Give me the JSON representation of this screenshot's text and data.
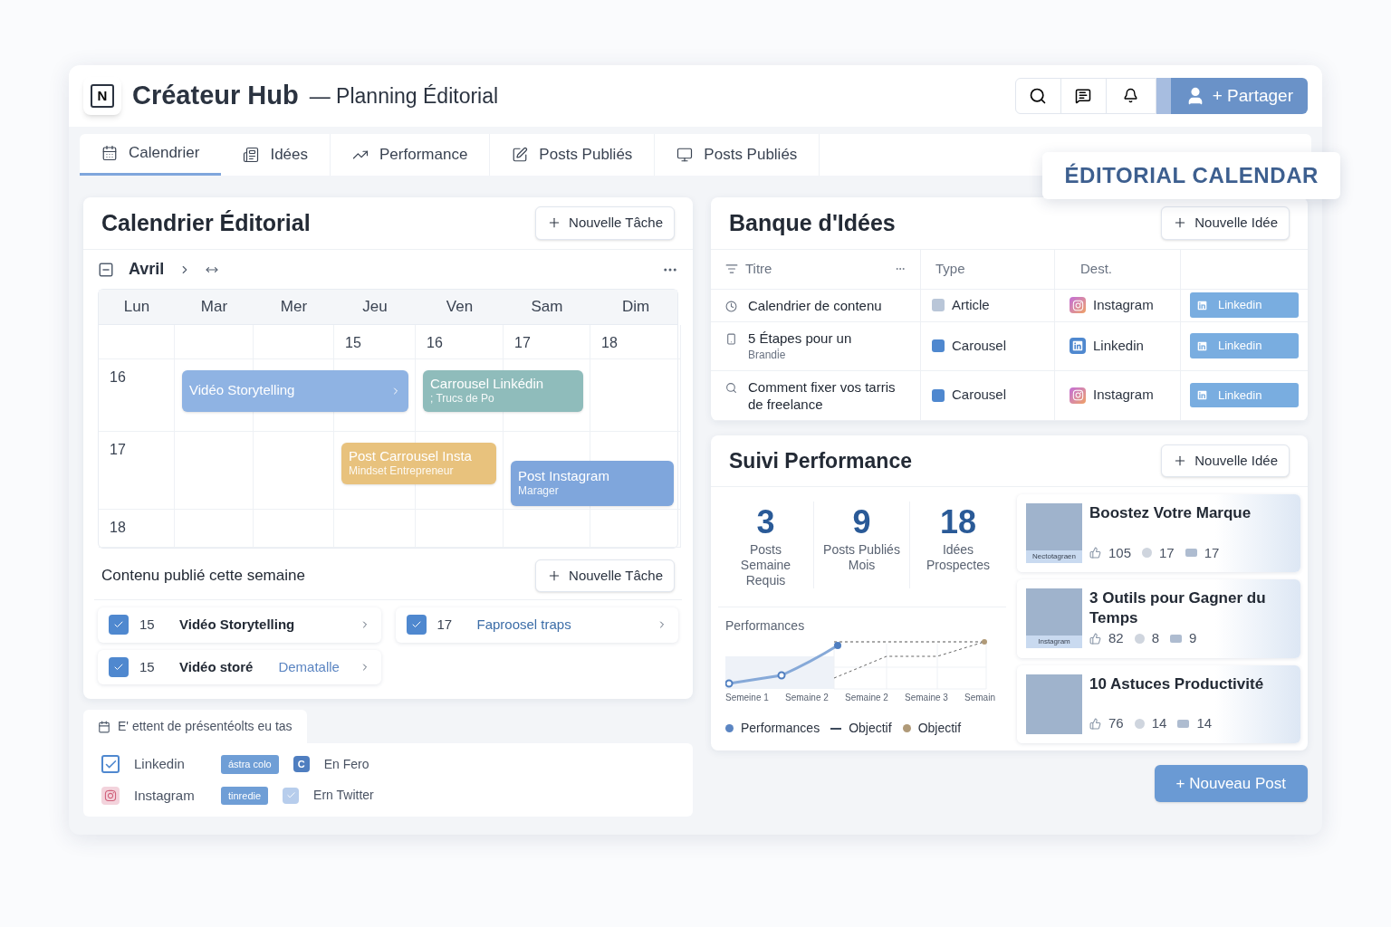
{
  "app": {
    "logo": "N",
    "name": "Créateur Hub",
    "subtitle": "— Planning Éditorial",
    "share_button": "+ Partager"
  },
  "tabs": [
    {
      "label": "Calendrier",
      "selected": true
    },
    {
      "label": "Idées",
      "selected": false
    },
    {
      "label": "Performance",
      "selected": false
    },
    {
      "label": "Posts Publiés",
      "selected": false
    },
    {
      "label": "Posts Publiés",
      "selected": false
    }
  ],
  "floating_badge": "ÉDITORIAL CALENDAR",
  "calendar": {
    "title": "Calendrier Éditorial",
    "new_button": "Nouvelle Tâche",
    "month": "Avril",
    "days": [
      "Lun",
      "Mar",
      "Mer",
      "Jeu",
      "Ven",
      "Sam",
      "Dim"
    ],
    "dates": [
      "15",
      "16",
      "17",
      "18",
      "16",
      "17",
      "18"
    ],
    "events": [
      {
        "title": "Vidéo Storytelling",
        "color": "#8fb3e3"
      },
      {
        "title": "Carrousel Linkédin",
        "subtitle": "; Trucs de Po",
        "color": "#8fbcbb"
      },
      {
        "title": "Post Carrousel Insta",
        "subtitle": "Mindset Entrepreneur",
        "color": "#e8c27d"
      },
      {
        "title": "Post Instagram",
        "subtitle": "Marager",
        "color": "#7fa6dc"
      }
    ]
  },
  "published": {
    "title": "Contenu publié cette semaine",
    "new_button": "Nouvelle Tâche",
    "items": [
      {
        "day": "15",
        "title": "Vidéo Storytelling",
        "highlight": false
      },
      {
        "day": "17",
        "title": "Faproosel traps",
        "highlight": true
      },
      {
        "day": "15",
        "title": "Vidéo storé",
        "tag": "Dematalle",
        "highlight": false
      }
    ]
  },
  "channels": {
    "tab": "E' ettent de présentéolts eu tas",
    "rows": [
      {
        "kind": "checkbox",
        "checked": true,
        "name": "Linkedin",
        "badge": "ástra colo",
        "letter": "C",
        "label": "En Fero"
      },
      {
        "kind": "instagram",
        "name": "Instagram",
        "badge": "tinredie",
        "label": "Ern Twitter"
      }
    ]
  },
  "ideas": {
    "title": "Banque d'Idées",
    "new_button": "Nouvelle Idée",
    "columns": [
      "Titre",
      "Type",
      "Dest."
    ],
    "rows": [
      {
        "title": "Calendrier de contenu",
        "type": {
          "kind": "article",
          "label": "Article"
        },
        "dest": {
          "kind": "instagram",
          "label": "Instagram"
        },
        "action": "Linkedin"
      },
      {
        "title": "5 Étapes pour un",
        "subtitle": "Brandi̇e",
        "type": {
          "kind": "carousel",
          "label": "Carousel"
        },
        "dest": {
          "kind": "linkedin",
          "label": "Linkedin"
        },
        "action": "Linkedin"
      },
      {
        "title": "Comment fixer vos tarris de freelance",
        "type": {
          "kind": "carousel",
          "label": "Carousel"
        },
        "dest": {
          "kind": "instagram",
          "label": "Instagram"
        },
        "action": "Linkedin"
      }
    ]
  },
  "performance": {
    "title": "Suivi Performance",
    "new_button": "Nouvelle Idée",
    "stats": [
      {
        "value": "3",
        "label": "Posts Semaine Requis"
      },
      {
        "value": "9",
        "label": "Posts Publiés Mois"
      },
      {
        "value": "18",
        "label": "Idées Prospectes"
      }
    ],
    "chart_title": "Performances",
    "x_labels": [
      "Semeine 1",
      "Semaine 2",
      "Semaine 2",
      "Semaine 3",
      "Semain"
    ],
    "legend": [
      {
        "kind": "dot",
        "label": "Performances",
        "color": "#5b85c2"
      },
      {
        "kind": "line",
        "label": "Objectif",
        "color": "#3d4a5c"
      },
      {
        "kind": "dot",
        "label": "Objectif",
        "color": "#b09a78"
      }
    ],
    "posts": [
      {
        "title": "Boostez Votre Marque",
        "caption": "Nectotagraen",
        "likes": "105",
        "comments": "17",
        "shares": "17"
      },
      {
        "title": "3 Outils pour Gagner du Temps",
        "caption": "Instagram",
        "likes": "82",
        "comments": "8",
        "shares": "9"
      },
      {
        "title": "10 Astuces Productivité",
        "likes": "76",
        "comments": "14",
        "shares": "14"
      }
    ]
  },
  "new_post_button": "+ Nouveau Post"
}
